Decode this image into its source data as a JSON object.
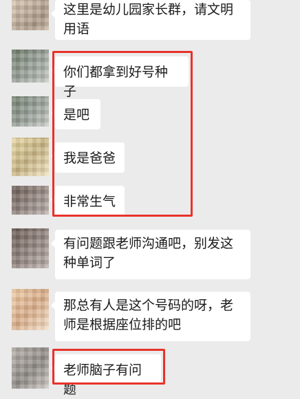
{
  "chat": {
    "messages": [
      {
        "text": "这里是幼儿园家长群，请文明用语"
      },
      {
        "text": "你们都拿到好号种子"
      },
      {
        "text": "是吧"
      },
      {
        "text": "我是爸爸"
      },
      {
        "text": "非常生气"
      },
      {
        "text": "有问题跟老师沟通吧，别发这种单词了"
      },
      {
        "text": "那总有人是这个号码的呀，老师是根据座位排的吧"
      },
      {
        "text": "老师脑子有问题"
      }
    ]
  },
  "colors": {
    "background": "#ebebeb",
    "bubble": "#ffffff",
    "highlight": "#e8322a"
  }
}
